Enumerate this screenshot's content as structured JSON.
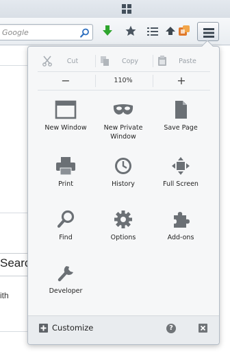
{
  "toolbar": {
    "search_placeholder": "Google"
  },
  "page": {
    "partial_search_text": "Searc",
    "partial_body_text": "ith"
  },
  "menu": {
    "edit": [
      {
        "name": "cut",
        "label": "Cut"
      },
      {
        "name": "copy",
        "label": "Copy"
      },
      {
        "name": "paste",
        "label": "Paste"
      }
    ],
    "zoom": {
      "out_symbol": "−",
      "level": "110%",
      "in_symbol": "+"
    },
    "items": [
      {
        "name": "new-window",
        "label": "New Window",
        "icon": "window-icon"
      },
      {
        "name": "new-private-window",
        "label": "New Private Window",
        "icon": "mask-icon"
      },
      {
        "name": "save-page",
        "label": "Save Page",
        "icon": "page-icon"
      },
      {
        "name": "print",
        "label": "Print",
        "icon": "printer-icon"
      },
      {
        "name": "history",
        "label": "History",
        "icon": "clock-icon"
      },
      {
        "name": "full-screen",
        "label": "Full Screen",
        "icon": "fullscreen-icon"
      },
      {
        "name": "find",
        "label": "Find",
        "icon": "magnifier-icon"
      },
      {
        "name": "options",
        "label": "Options",
        "icon": "gear-icon"
      },
      {
        "name": "add-ons",
        "label": "Add-ons",
        "icon": "puzzle-icon"
      },
      {
        "name": "developer",
        "label": "Developer",
        "icon": "wrench-icon"
      }
    ],
    "footer": {
      "customize_label": "Customize",
      "help_symbol": "?"
    }
  },
  "colors": {
    "icon_gray": "#6b7075",
    "download_green": "#2ea52e",
    "panel_bg": "#f6f7f8"
  }
}
